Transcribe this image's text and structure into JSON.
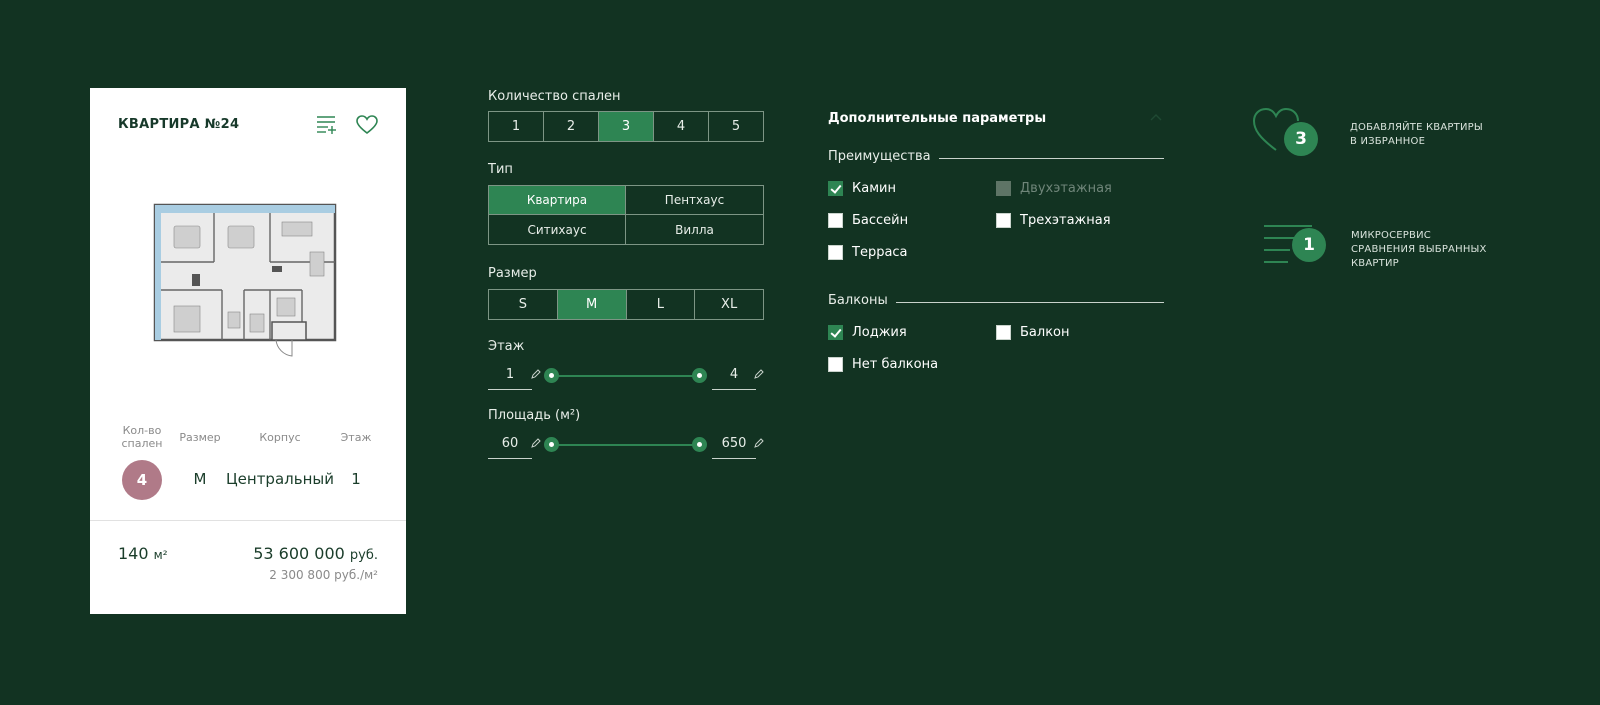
{
  "card": {
    "title": "КВАРТИРА №24",
    "icons": [
      "compare-list-icon",
      "heart-icon"
    ],
    "labels": {
      "bedrooms": "Кол-во спален",
      "size": "Размер",
      "building": "Корпус",
      "floor": "Этаж"
    },
    "values": {
      "bedrooms": "4",
      "size": "M",
      "building": "Центральный",
      "floor": "1"
    },
    "area_value": "140",
    "area_unit": "м²",
    "price_value": "53 600 000",
    "price_unit": "руб.",
    "price_per_m2": "2 300 800 руб./м²",
    "colors": {
      "bedroom_badge": "#b07a88",
      "text": "#1a3d2a"
    }
  },
  "filters": {
    "bedrooms": {
      "label": "Количество спален",
      "options": [
        "1",
        "2",
        "3",
        "4",
        "5"
      ],
      "selected": "3"
    },
    "type": {
      "label": "Тип",
      "options": [
        "Квартира",
        "Пентхаус",
        "Ситихаус",
        "Вилла"
      ],
      "selected": "Квартира"
    },
    "size": {
      "label": "Размер",
      "options": [
        "S",
        "M",
        "L",
        "XL"
      ],
      "selected": "M"
    },
    "floor": {
      "label": "Этаж",
      "min": "1",
      "max": "4"
    },
    "area": {
      "label": "Площадь (м²)",
      "min": "60",
      "max": "650"
    }
  },
  "additional": {
    "title": "Дополнительные параметры",
    "advantages": {
      "title": "Преимущества",
      "items": [
        {
          "label": "Камин",
          "checked": true,
          "disabled": false
        },
        {
          "label": "Двухэтажная",
          "checked": false,
          "disabled": true
        },
        {
          "label": "Бассейн",
          "checked": false,
          "disabled": false
        },
        {
          "label": "Трехэтажная",
          "checked": false,
          "disabled": false
        },
        {
          "label": "Терраса",
          "checked": false,
          "disabled": false
        }
      ]
    },
    "balconies": {
      "title": "Балконы",
      "items": [
        {
          "label": "Лоджия",
          "checked": true,
          "disabled": false
        },
        {
          "label": "Балкон",
          "checked": false,
          "disabled": false
        },
        {
          "label": "Нет балкона",
          "checked": false,
          "disabled": false
        }
      ]
    }
  },
  "promos": {
    "favorites": {
      "count": "3",
      "line1": "ДОБАВЛЯЙТЕ КВАРТИРЫ",
      "line2": "В ИЗБРАННОЕ",
      "icon": "heart-icon"
    },
    "compare": {
      "count": "1",
      "line1": "МИКРОСЕРВИС",
      "line2": "СРАВНЕНИЯ ВЫБРАННЫХ",
      "line3": "КВАРТИР",
      "icon": "list-icon"
    }
  },
  "colors": {
    "background": "#123322",
    "accent": "#2e8553",
    "border": "#7d9585"
  }
}
